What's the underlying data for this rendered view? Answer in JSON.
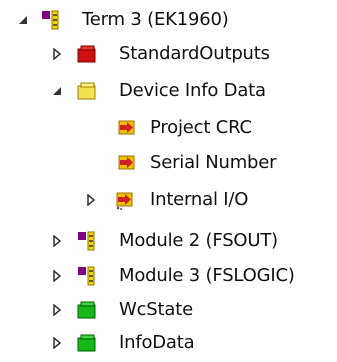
{
  "tree": {
    "root": {
      "label": "Term 3 (EK1960)",
      "icon": "module-icon",
      "expanded": true
    },
    "standard_outputs": {
      "label": "StandardOutputs",
      "icon": "red-folder-icon",
      "expanded": false
    },
    "device_info": {
      "label": "Device Info Data",
      "icon": "yellow-folder-icon",
      "expanded": true,
      "children": {
        "project_crc": {
          "label": "Project CRC",
          "icon": "input-variable-icon"
        },
        "serial_number": {
          "label": "Serial Number",
          "icon": "input-variable-icon"
        },
        "internal_io": {
          "label": "Internal I/O",
          "icon": "input-variable-icon",
          "expanded": false
        }
      }
    },
    "module2": {
      "label": "Module 2 (FSOUT)",
      "icon": "module-icon",
      "expanded": false
    },
    "module3": {
      "label": "Module 3 (FSLOGIC)",
      "icon": "module-icon",
      "expanded": false
    },
    "wcstate": {
      "label": "WcState",
      "icon": "green-folder-icon",
      "expanded": false
    },
    "infodata": {
      "label": "InfoData",
      "icon": "green-folder-icon",
      "expanded": false
    }
  },
  "colors": {
    "module_purple": "#800080",
    "module_yellow": "#f0d400",
    "folder_red": "#d01010",
    "folder_yellow": "#f5e050",
    "folder_green": "#18b818",
    "variable_red": "#d02020",
    "variable_yellow": "#f0c000"
  }
}
